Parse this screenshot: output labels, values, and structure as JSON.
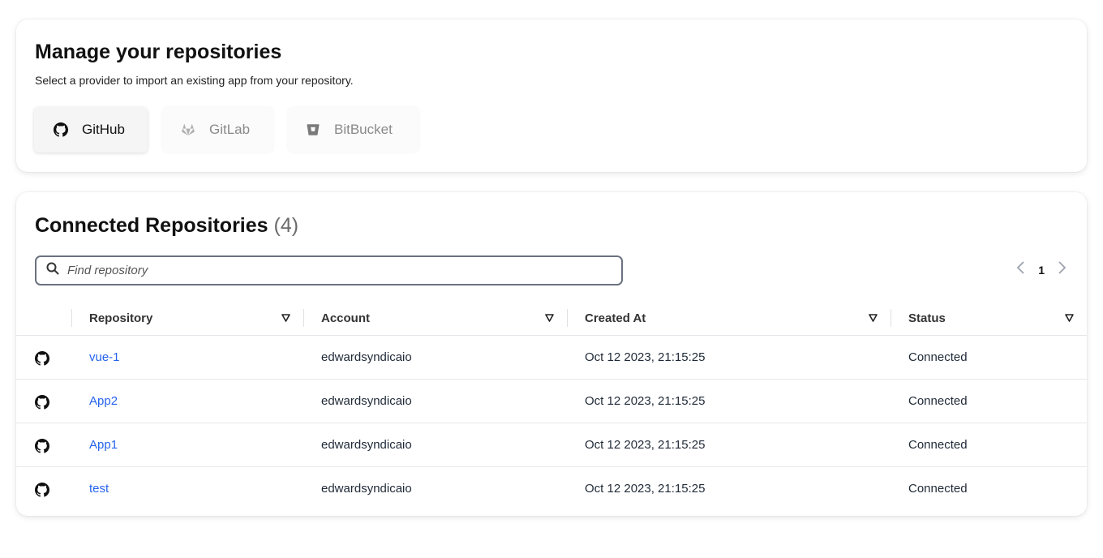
{
  "manage": {
    "title": "Manage your repositories",
    "subtitle": "Select a provider to import an existing app from your repository.",
    "providers": [
      {
        "label": "GitHub",
        "icon": "github-icon",
        "active": true
      },
      {
        "label": "GitLab",
        "icon": "gitlab-icon",
        "active": false
      },
      {
        "label": "BitBucket",
        "icon": "bitbucket-icon",
        "active": false
      }
    ]
  },
  "repos": {
    "title": "Connected Repositories",
    "count": "(4)",
    "search_placeholder": "Find repository",
    "page": "1",
    "columns": [
      "Repository",
      "Account",
      "Created At",
      "Status"
    ],
    "rows": [
      {
        "repository": "vue-1",
        "account": "edwardsyndicaio",
        "created_at": "Oct 12 2023, 21:15:25",
        "status": "Connected"
      },
      {
        "repository": "App2",
        "account": "edwardsyndicaio",
        "created_at": "Oct 12 2023, 21:15:25",
        "status": "Connected"
      },
      {
        "repository": "App1",
        "account": "edwardsyndicaio",
        "created_at": "Oct 12 2023, 21:15:25",
        "status": "Connected"
      },
      {
        "repository": "test",
        "account": "edwardsyndicaio",
        "created_at": "Oct 12 2023, 21:15:25",
        "status": "Connected"
      }
    ]
  },
  "colors": {
    "link": "#2563eb",
    "title": "#111111",
    "muted": "#8a8a8a"
  }
}
